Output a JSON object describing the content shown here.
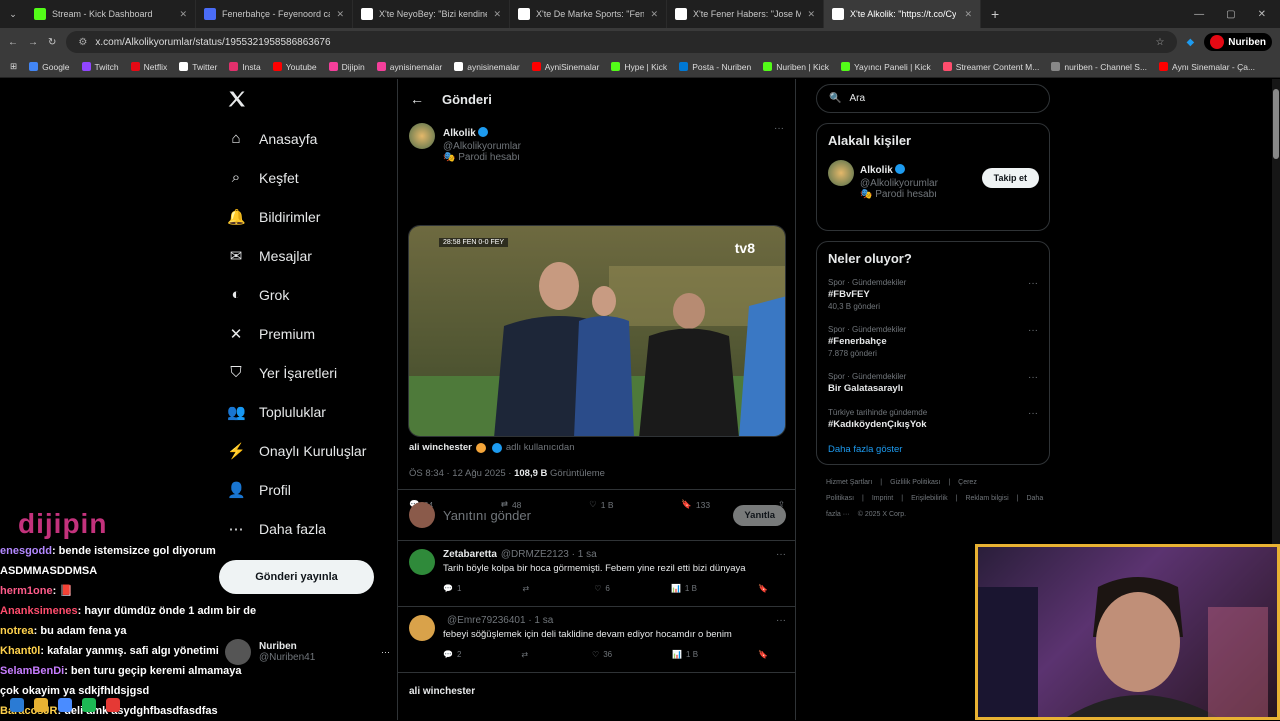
{
  "browser": {
    "tabs": [
      {
        "title": "Stream - Kick Dashboard",
        "color": "#53fc18",
        "active": false
      },
      {
        "title": "Fenerbahçe - Feyenoord canlı s",
        "color": "#4a6cf7",
        "active": false
      },
      {
        "title": "X'te NeyoBey: \"Bizi kendine ba",
        "color": "#ffffff",
        "active": false
      },
      {
        "title": "X'te De Marke Sports: \"Fenerba",
        "color": "#ffffff",
        "active": false
      },
      {
        "title": "X'te Fener Habers: \"Jose Mouri",
        "color": "#ffffff",
        "active": false
      },
      {
        "title": "X'te Alkolik: \"https://t.co/Cy",
        "color": "#ffffff",
        "active": true
      }
    ],
    "url": "x.com/Alkolikyorumlar/status/1955321958586863676",
    "bookmarks": [
      {
        "label": "Google",
        "color": "#4285f4"
      },
      {
        "label": "Twitch",
        "color": "#9146ff"
      },
      {
        "label": "Netflix",
        "color": "#e50914"
      },
      {
        "label": "Twitter",
        "color": "#ffffff"
      },
      {
        "label": "Insta",
        "color": "#e1306c"
      },
      {
        "label": "Youtube",
        "color": "#ff0000"
      },
      {
        "label": "Dijipin",
        "color": "#f43f9b"
      },
      {
        "label": "aynisinemalar",
        "color": "#f43f9b"
      },
      {
        "label": "aynisinemalar",
        "color": "#ffffff"
      },
      {
        "label": "AyniSinemalar",
        "color": "#ff0000"
      },
      {
        "label": "Hype | Kick",
        "color": "#53fc18"
      },
      {
        "label": "Posta - Nuriben",
        "color": "#0078d4"
      },
      {
        "label": "Nuriben | Kick",
        "color": "#53fc18"
      },
      {
        "label": "Yayıncı Paneli | Kick",
        "color": "#53fc18"
      },
      {
        "label": "Streamer Content M...",
        "color": "#ff4d6d"
      },
      {
        "label": "nuriben - Channel S...",
        "color": "#888888"
      },
      {
        "label": "Aynı Sinemalar - Ça...",
        "color": "#ff0000"
      }
    ],
    "yt_badge": "Nuriben"
  },
  "nav": {
    "items": [
      "Anasayfa",
      "Keşfet",
      "Bildirimler",
      "Mesajlar",
      "Grok",
      "Premium",
      "Yer İşaretleri",
      "Topluluklar",
      "Onaylı Kuruluşlar",
      "Profil",
      "Daha fazla"
    ],
    "post_button": "Gönderi yayınla",
    "profile_name": "Nuriben",
    "profile_handle": "@Nuriben41"
  },
  "main": {
    "header": "Gönderi",
    "author_name": "Alkolik",
    "author_handle": "@Alkolikyorumlar",
    "parody": "Parodi hesabı",
    "video_score": "28:58 FEN 0-0 FEY",
    "video_channel": "tv8",
    "credit_name": "ali winchester",
    "credit_suffix": "adlı kullanıcıdan",
    "time": "ÖS 8:34 · 12 Ağu 2025 ·",
    "views": "108,9 B",
    "views_label": "Görüntüleme",
    "stats": {
      "replies": "64",
      "retweets": "48",
      "likes": "1 B",
      "bookmarks": "133"
    },
    "reply_placeholder": "Yanıtını gönder",
    "reply_button": "Yanıtla",
    "replies": [
      {
        "name": "Zetabaretta",
        "handle": "@DRMZE2123 · 1 sa",
        "text": "Tarih böyle kolpa bir hoca görmemişti. Febem yine rezil etti bizi dünyaya",
        "r": "1",
        "rt": "",
        "l": "6",
        "v": "1 B"
      },
      {
        "name": "",
        "handle": "@Emre79236401 · 1 sa",
        "text": "febeyi söğüşlemek için deli taklidine devam ediyor hocamdır o benim",
        "r": "2",
        "rt": "",
        "l": "36",
        "v": "1 B"
      }
    ],
    "partial_reply": "ali winchester"
  },
  "right": {
    "search_placeholder": "Ara",
    "related_title": "Alakalı kişiler",
    "related_name": "Alkolik",
    "related_handle": "@Alkolikyorumlar",
    "related_parody": "Parodi hesabı",
    "follow": "Takip et",
    "trends_title": "Neler oluyor?",
    "trends": [
      {
        "cat": "Spor · Gündemdekiler",
        "tag": "#FBvFEY",
        "count": "40,3 B gönderi"
      },
      {
        "cat": "Spor · Gündemdekiler",
        "tag": "#Fenerbahçe",
        "count": "7.878 gönderi"
      },
      {
        "cat": "Spor · Gündemdekiler",
        "tag": "Bir Galatasaraylı",
        "count": ""
      },
      {
        "cat": "Türkiye tarihinde gündemde",
        "tag": "#KadıköydenÇıkışYok",
        "count": ""
      }
    ],
    "show_more": "Daha fazla göster",
    "footer": [
      "Hizmet Şartları",
      "|",
      "Gizlilik Politikası",
      "|",
      "Çerez Politikası",
      "|",
      "Imprint",
      "|",
      "Erişilebilirlik",
      "|",
      "Reklam bilgisi",
      "|",
      "Daha fazla ···",
      "© 2025 X Corp."
    ]
  },
  "overlay": {
    "logo": "dijipin",
    "chat": [
      {
        "user": "enesgodd",
        "color": "#b388ff",
        "msg": ": bende istemsizce gol diyorum"
      },
      {
        "user": "",
        "color": "#ffffff",
        "msg": "ASDMMASDDMSA"
      },
      {
        "user": "herm1one",
        "color": "#ff5c8a",
        "msg": ": 📕"
      },
      {
        "user": "Ananksimenes",
        "color": "#ff4d6d",
        "msg": ": hayır dümdüz önde 1 adım bir de"
      },
      {
        "user": "notrea",
        "color": "#ffd24d",
        "msg": ": bu adam fena ya"
      },
      {
        "user": "Khant0l",
        "color": "#ffd24d",
        "msg": ": kafalar yanmış. safi algı yönetimi"
      },
      {
        "user": "SelamBenDi",
        "color": "#c77dff",
        "msg": ": ben turu geçip keremi almamaya"
      },
      {
        "user": "",
        "color": "#ffffff",
        "msg": "çok okayim ya sdkjfhldsjgsd"
      },
      {
        "user": "BaracosJR",
        "color": "#ffd24d",
        "msg": ": deli amk asydghfbasdfasdfas"
      }
    ]
  }
}
